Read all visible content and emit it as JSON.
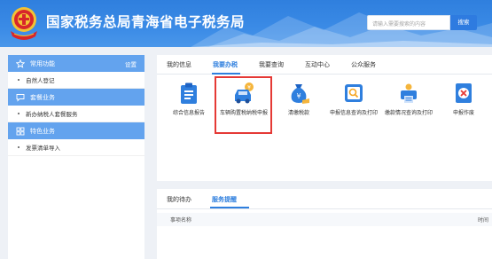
{
  "header": {
    "title": "国家税务总局青海省电子税务局",
    "search_placeholder": "请输入需要搜索的内容",
    "search_button": "搜索",
    "colors": {
      "primary": "#2f7fde",
      "light": "#63a3ee"
    }
  },
  "sidebar": {
    "sections": [
      {
        "title": "常用功能",
        "icon": "star-icon",
        "action": "设置",
        "items": [
          "自然人登记"
        ]
      },
      {
        "title": "套餐业务",
        "icon": "chat-icon",
        "items": [
          "新办纳税人套餐服务"
        ]
      },
      {
        "title": "特色业务",
        "icon": "grid-icon",
        "items": [
          "发票清单导入"
        ]
      }
    ]
  },
  "main": {
    "tabs": [
      "我的信息",
      "我要办税",
      "我要查询",
      "互动中心",
      "公众服务"
    ],
    "active_tab": "我要办税",
    "functions": [
      {
        "label": "综合信息报告",
        "icon": "clipboard-icon"
      },
      {
        "label": "车辆购置税纳税申报",
        "icon": "car-tax-icon",
        "highlighted": true
      },
      {
        "label": "清缴税款",
        "icon": "money-bag-icon"
      },
      {
        "label": "申报信息查询及打印",
        "icon": "search-document-icon"
      },
      {
        "label": "缴款情况查询及打印",
        "icon": "printer-icon"
      },
      {
        "label": "申报作废",
        "icon": "void-document-icon"
      }
    ]
  },
  "lower": {
    "tabs": [
      "我的待办",
      "服务提醒"
    ],
    "active_tab": "服务提醒",
    "columns": [
      "事项名称",
      "时间"
    ]
  }
}
